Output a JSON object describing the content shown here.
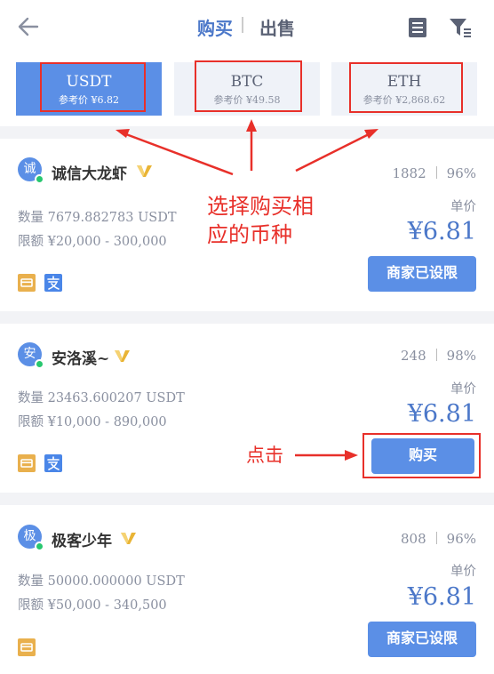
{
  "header": {
    "buy_tab": "购买",
    "sell_tab": "出售",
    "back_icon": "arrow-left-icon",
    "orders_icon": "document-icon",
    "filter_icon": "filter-icon"
  },
  "coins": [
    {
      "name": "USDT",
      "price": "参考价 ¥6.82",
      "active": true
    },
    {
      "name": "BTC",
      "price": "参考价 ¥49.58",
      "active": false
    },
    {
      "name": "ETH",
      "price": "参考价 ¥2,868.62",
      "active": false
    }
  ],
  "listings": [
    {
      "avatar": "诚",
      "merchant": "诚信大龙虾",
      "orders": "1882",
      "rate": "96%",
      "quantity": "数量 7679.882783 USDT",
      "limit": "限额 ¥20,000 - 300,000",
      "unit_label": "单价",
      "price": "¥6.81",
      "button": "商家已设限",
      "payments": [
        "bank-card-icon",
        "alipay-icon"
      ]
    },
    {
      "avatar": "安",
      "merchant": "安洛溪~",
      "orders": "248",
      "rate": "98%",
      "quantity": "数量 23463.600207 USDT",
      "limit": "限额 ¥10,000 - 890,000",
      "unit_label": "单价",
      "price": "¥6.81",
      "button": "购买",
      "payments": [
        "bank-card-icon",
        "alipay-icon"
      ]
    },
    {
      "avatar": "极",
      "merchant": "极客少年",
      "orders": "808",
      "rate": "96%",
      "quantity": "数量 50000.000000 USDT",
      "limit": "限额 ¥50,000 - 340,500",
      "unit_label": "单价",
      "price": "¥6.81",
      "button": "商家已设限",
      "payments": [
        "bank-card-icon"
      ]
    }
  ],
  "annotations": {
    "choose_coin": "选择购买相应的币种",
    "click": "点击"
  },
  "colors": {
    "accent": "#5b8fe6",
    "price": "#4c78c9",
    "annotation": "#e8302a",
    "online": "#28c76f",
    "vip": "#e9b435",
    "card_icon": "#e9b04d"
  }
}
